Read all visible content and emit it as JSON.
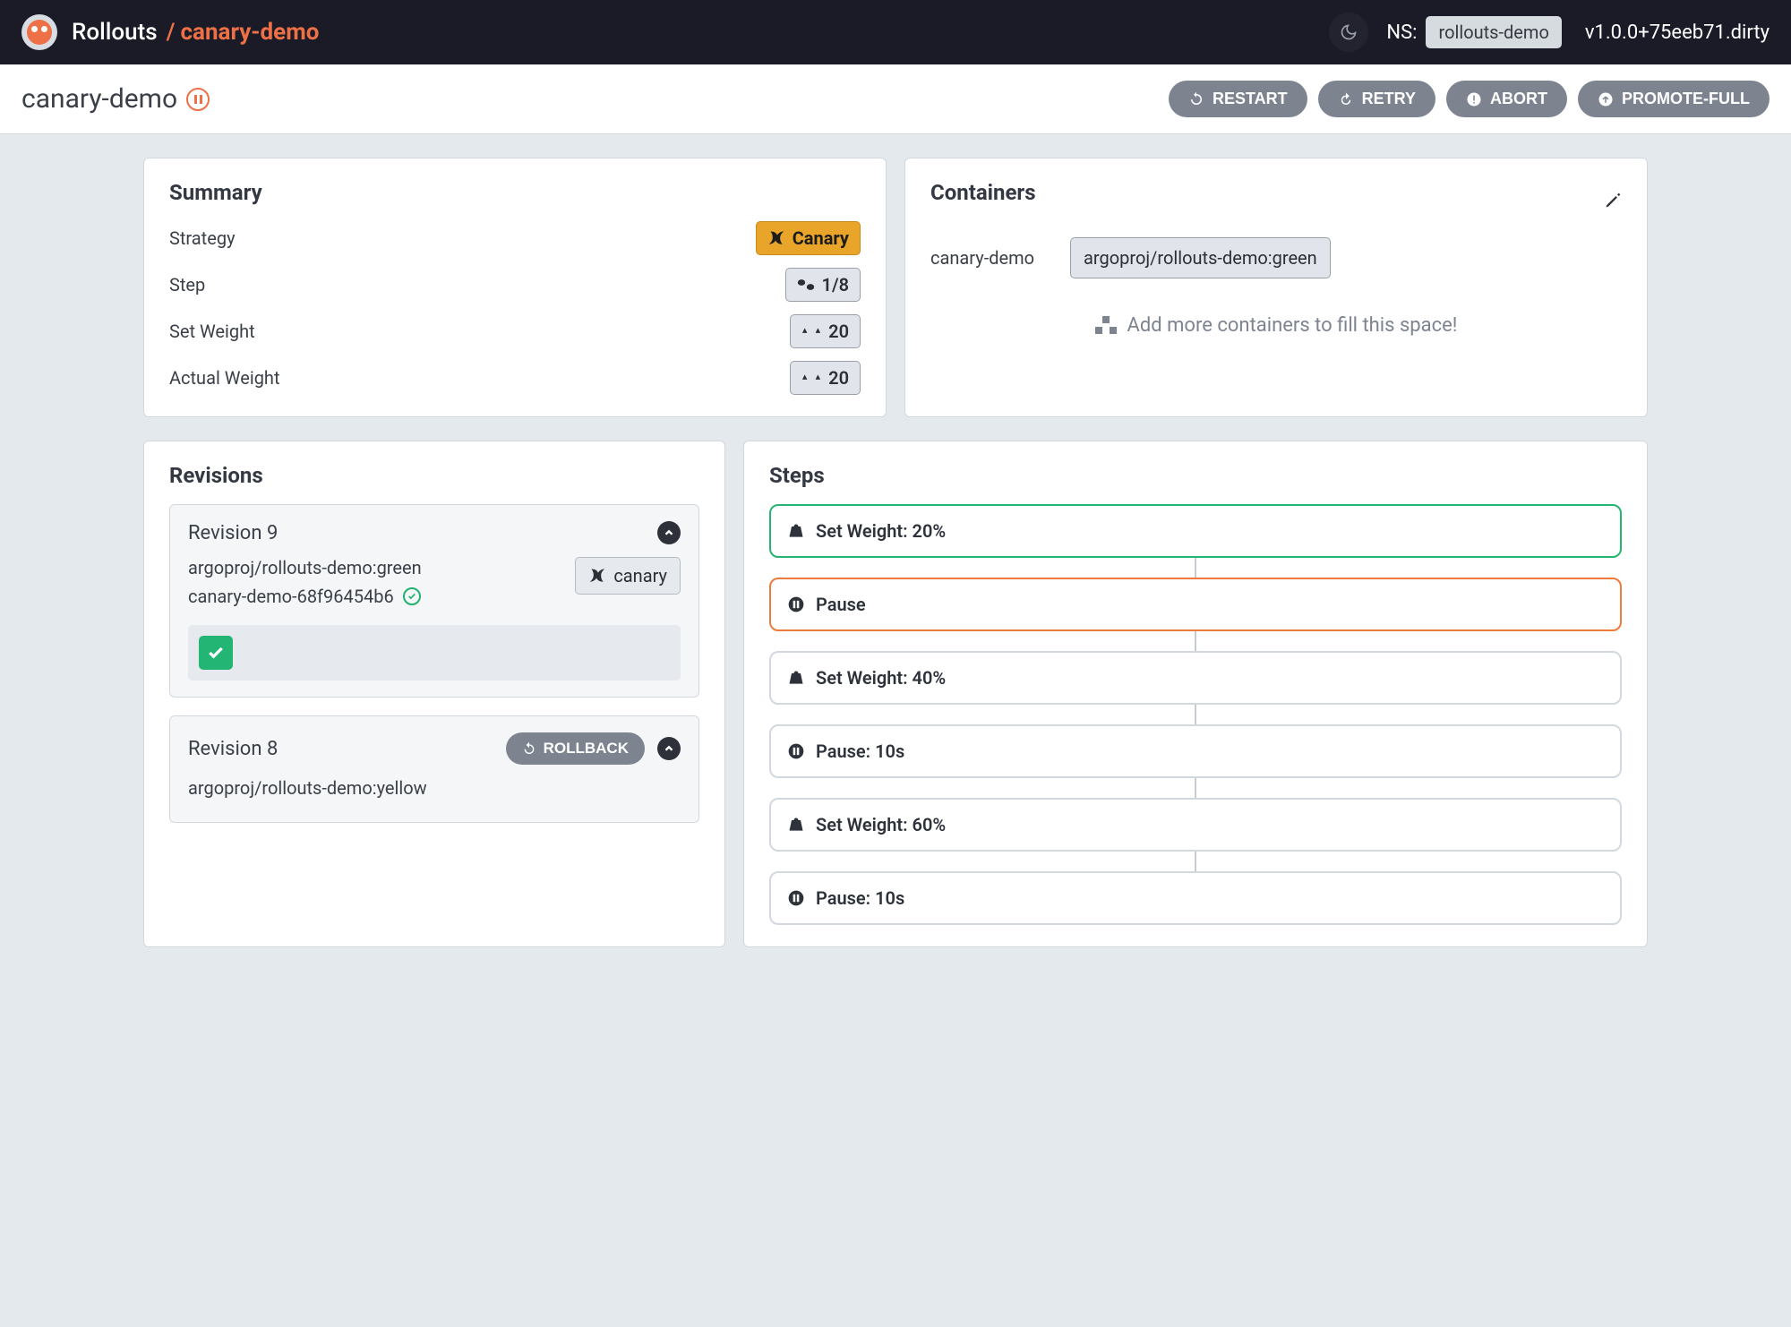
{
  "header": {
    "brand": "Rollouts",
    "breadcrumb_sep": "/",
    "breadcrumb_current": "canary-demo",
    "ns_label": "NS:",
    "namespace": "rollouts-demo",
    "version": "v1.0.0+75eeb71.dirty"
  },
  "subheader": {
    "title": "canary-demo",
    "actions": {
      "restart": "RESTART",
      "retry": "RETRY",
      "abort": "ABORT",
      "promote_full": "PROMOTE-FULL"
    }
  },
  "summary": {
    "title": "Summary",
    "labels": {
      "strategy": "Strategy",
      "step": "Step",
      "set_weight": "Set Weight",
      "actual_weight": "Actual Weight"
    },
    "values": {
      "strategy": "Canary",
      "step": "1/8",
      "set_weight": "20",
      "actual_weight": "20"
    }
  },
  "containers": {
    "title": "Containers",
    "items": [
      {
        "name": "canary-demo",
        "image": "argoproj/rollouts-demo:green"
      }
    ],
    "add_more": "Add more containers to fill this space!"
  },
  "revisions": {
    "title": "Revisions",
    "items": [
      {
        "title": "Revision 9",
        "image": "argoproj/rollouts-demo:green",
        "rs": "canary-demo-68f96454b6",
        "tag": "canary",
        "expanded": true
      },
      {
        "title": "Revision 8",
        "image": "argoproj/rollouts-demo:yellow",
        "rollback_label": "ROLLBACK",
        "expanded": false
      }
    ]
  },
  "steps": {
    "title": "Steps",
    "items": [
      {
        "label": "Set Weight: 20%",
        "state": "done",
        "icon": "weight"
      },
      {
        "label": "Pause",
        "state": "current",
        "icon": "pause"
      },
      {
        "label": "Set Weight: 40%",
        "state": "pending",
        "icon": "weight"
      },
      {
        "label": "Pause: 10s",
        "state": "pending",
        "icon": "pause"
      },
      {
        "label": "Set Weight: 60%",
        "state": "pending",
        "icon": "weight"
      },
      {
        "label": "Pause: 10s",
        "state": "pending",
        "icon": "pause"
      }
    ]
  }
}
